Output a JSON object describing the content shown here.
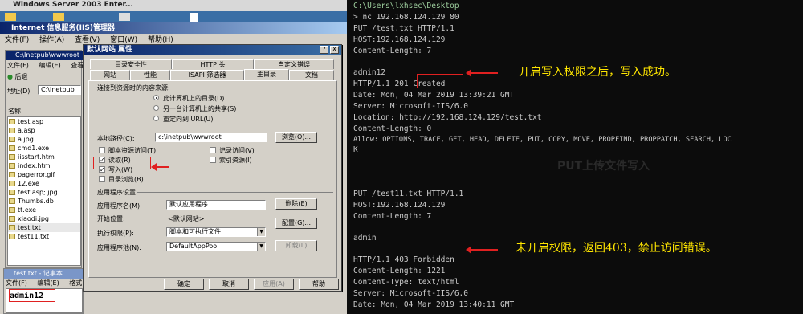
{
  "vm_title": "Windows Server 2003 Enter...",
  "iis": {
    "title": "Internet 信息服务(IIS)管理器",
    "menu": [
      "文件(F)",
      "操作(A)",
      "查看(V)",
      "窗口(W)",
      "帮助(H)"
    ]
  },
  "explorer": {
    "title": "C:\\Inetpub\\wwwroot",
    "menu": [
      "文件(F)",
      "编辑(E)",
      "查看(V)"
    ],
    "back_label": "后退",
    "address_label": "地址(D)",
    "address_value": "C:\\Inetpub",
    "name_header": "名称",
    "files": [
      "test.asp",
      "a.asp",
      "a.jpg",
      "cmd1.exe",
      "iisstart.htm",
      "index.html",
      "pagerror.gif",
      "12.exe",
      "test.asp;.jpg",
      "Thumbs.db",
      "tt.exe",
      "xiaodi.jpg",
      "test.txt",
      "test11.txt"
    ]
  },
  "notepad": {
    "title": "test.txt - 记事本",
    "menu": [
      "文件(F)",
      "编辑(E)",
      "格式"
    ],
    "text": "admin12"
  },
  "dialog": {
    "title": "默认网站 属性",
    "help_btn": "?",
    "close_btn": "X",
    "tabs_row1": [
      "目录安全性",
      "HTTP 头",
      "自定义错误"
    ],
    "tabs_row2": [
      "网站",
      "性能",
      "ISAPI 筛选器",
      "主目录",
      "文档"
    ],
    "content_source_label": "连接到资源时的内容来源:",
    "radio_options": [
      "此计算机上的目录(D)",
      "另一台计算机上的共享(S)",
      "重定向到 URL(U)"
    ],
    "local_path_label": "本地路径(C):",
    "local_path_value": "c:\\inetpub\\wwwroot",
    "browse_btn": "浏览(O)...",
    "checkboxes_left": [
      {
        "label": "脚本资源访问(T)",
        "checked": false
      },
      {
        "label": "读取(R)",
        "checked": true
      },
      {
        "label": "写入(W)",
        "checked": true
      },
      {
        "label": "目录浏览(B)",
        "checked": false
      }
    ],
    "checkboxes_right": [
      {
        "label": "记录访问(V)",
        "checked": false
      },
      {
        "label": "索引资源(I)",
        "checked": false
      }
    ],
    "app_settings_label": "应用程序设置",
    "app_name_label": "应用程序名(M):",
    "app_name_value": "默认应用程序",
    "remove_btn": "删除(E)",
    "start_point_label": "开始位置:",
    "start_point_value": "<默认网站>",
    "config_btn": "配置(G)...",
    "exec_perm_label": "执行权限(P):",
    "exec_perm_value": "脚本和可执行文件",
    "app_pool_label": "应用程序池(N):",
    "app_pool_value": "DefaultAppPool",
    "unload_btn": "卸载(L)",
    "ok_btn": "确定",
    "cancel_btn": "取消",
    "apply_btn": "应用(A)",
    "help_bottom_btn": "帮助"
  },
  "terminal": {
    "lines_top": [
      "C:\\Users\\lxhsec\\Desktop",
      "> nc 192.168.124.129 80",
      "PUT /test.txt HTTP/1.1",
      "HOST:192.168.124.129",
      "Content-Length: 7",
      "",
      "admin12",
      "HTTP/1.1 201 Created",
      "Date: Mon, 04 Mar 2019 13:39:21 GMT",
      "Server: Microsoft-IIS/6.0",
      "Location: http://192.168.124.129/test.txt",
      "Content-Length: 0",
      "Allow: OPTIONS, TRACE, GET, HEAD, DELETE, PUT, COPY, MOVE, PROPFIND, PROPPATCH, SEARCH, LOC",
      "K"
    ],
    "lines_bottom": [
      "PUT /test11.txt HTTP/1.1",
      "HOST:192.168.124.129",
      "Content-Length: 7",
      "",
      "admin",
      "",
      "HTTP/1.1 403 Forbidden",
      "Content-Length: 1221",
      "Content-Type: text/html",
      "Server: Microsoft-IIS/6.0",
      "Date: Mon, 04 Mar 2019 13:40:11 GMT"
    ],
    "annotation_success": "开启写入权限之后，写入成功。",
    "annotation_fail": "未开启权限，返回403，禁止访问错误。",
    "faint_bg_text": "PUT上传文件写入"
  },
  "colors": {
    "annotation": "#ffe600",
    "highlight_box": "#e02020",
    "terminal_bg": "#0c0c0c",
    "terminal_text": "#cccccc"
  }
}
